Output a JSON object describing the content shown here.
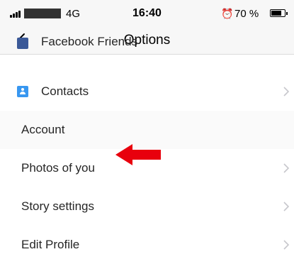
{
  "status_bar": {
    "network": "4G",
    "time": "16:40",
    "battery": "70 %",
    "battery_level": 0.7
  },
  "header": {
    "title": "Options",
    "back_icon": "chevron-left-icon"
  },
  "rows": {
    "partial": {
      "label": "Facebook Friends",
      "icon": "facebook-icon"
    },
    "contacts": {
      "label": "Contacts",
      "icon": "contacts-icon"
    },
    "account_header": {
      "label": "Account"
    },
    "photos_of_you": {
      "label": "Photos of you"
    },
    "story_settings": {
      "label": "Story settings"
    },
    "edit_profile": {
      "label": "Edit Profile"
    }
  },
  "annotation": {
    "arrow_color": "#e8000d"
  },
  "colors": {
    "accent": "#3897f0",
    "facebook": "#3b5998",
    "text": "#262626",
    "chevron": "#c7c7cc"
  }
}
